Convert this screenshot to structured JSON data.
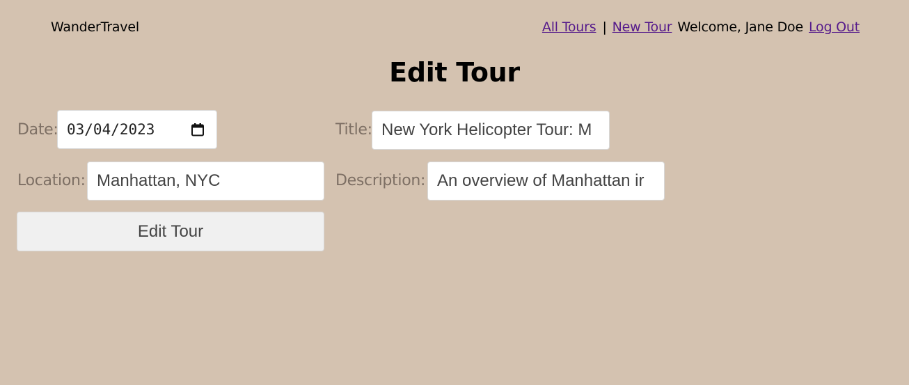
{
  "navbar": {
    "brand": "WanderTravel",
    "links": {
      "all_tours": "All Tours",
      "separator": "|",
      "new_tour": "New Tour",
      "welcome": "Welcome, Jane Doe",
      "log_out": "Log Out"
    }
  },
  "page": {
    "title": "Edit Tour"
  },
  "form": {
    "date": {
      "label": "Date:",
      "value": "03/04/2023"
    },
    "title": {
      "label": "Title:",
      "value": "New York Helicopter Tour: M"
    },
    "location": {
      "label": "Location:",
      "value": "Manhattan, NYC"
    },
    "description": {
      "label": "Description:",
      "value": "An overview of Manhattan ir"
    },
    "submit_label": "Edit Tour"
  },
  "colors": {
    "background": "#d4c2b0",
    "link": "#551a8b",
    "label": "#7d6f64"
  },
  "icons": {
    "date_picker": "calendar-icon"
  }
}
